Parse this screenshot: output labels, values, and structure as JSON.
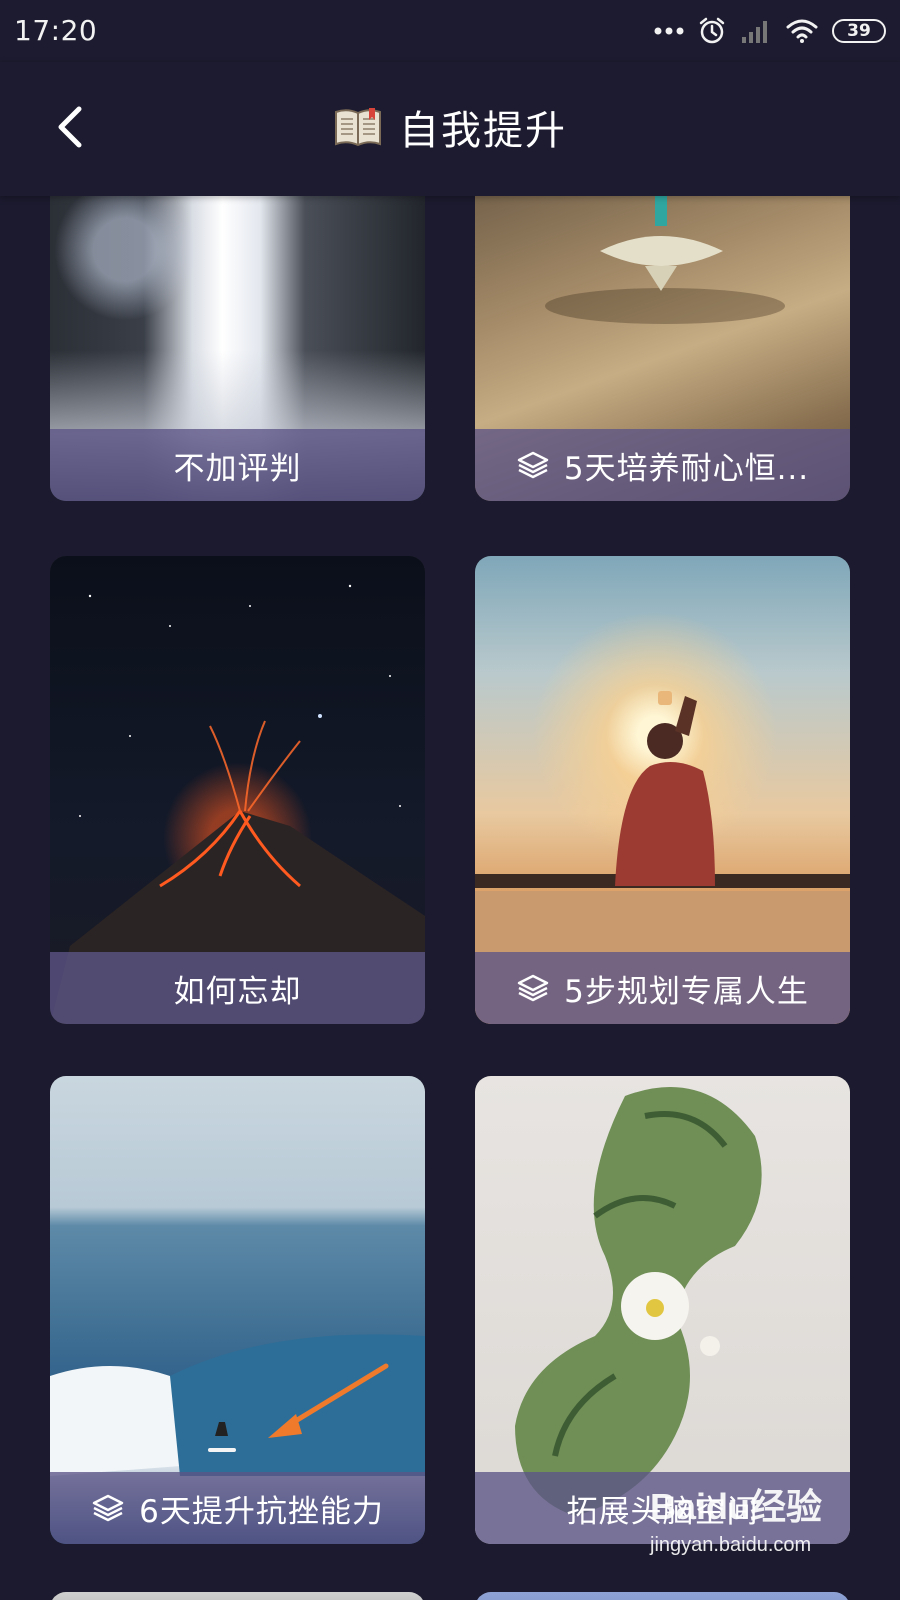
{
  "status_bar": {
    "time": "17:20",
    "battery": "39"
  },
  "header": {
    "title": "自我提升",
    "back_icon": "chevron-left-icon",
    "title_icon": "open-book-icon"
  },
  "cards": [
    {
      "label": "不加评判",
      "series": false,
      "image": "waterfall"
    },
    {
      "label": "5天培养耐心恒...",
      "series": true,
      "image": "spinning-top"
    },
    {
      "label": "如何忘却",
      "series": false,
      "image": "volcano-night-sky"
    },
    {
      "label": "5步规划专属人生",
      "series": true,
      "image": "man-holding-sun"
    },
    {
      "label": "6天提升抗挫能力",
      "series": true,
      "image": "surfer-wave"
    },
    {
      "label": "拓展头脑空间",
      "series": false,
      "image": "leaf-flower-head"
    }
  ],
  "annotation": {
    "arrow_color": "#f07a2c",
    "points_to": "6天提升抗挫能力"
  },
  "watermark": {
    "logo": "Baidu经验",
    "url": "jingyan.baidu.com"
  },
  "colors": {
    "background": "#1b1a2e",
    "label_bar": "#5c5487"
  }
}
